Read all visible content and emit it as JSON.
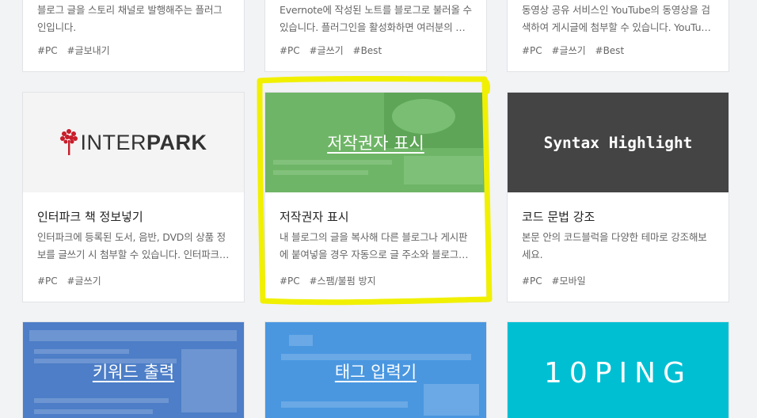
{
  "cards": [
    {
      "title": "",
      "desc": "블로그 글을 스토리 채널로 발행해주는 플러그인입니다.",
      "tags": [
        "#PC",
        "#글보내기"
      ]
    },
    {
      "title": "",
      "desc": "Evernote에 작성된 노트를 블로그로 불러올 수 있습니다. 플러그인을 활성화하면 여러분의 …",
      "tags": [
        "#PC",
        "#글쓰기",
        "#Best"
      ]
    },
    {
      "title": "",
      "desc": "동영상 공유 서비스인 YouTube의 동영상을 검색하여 게시글에 첨부할 수 있습니다. YouTu…",
      "tags": [
        "#PC",
        "#글쓰기",
        "#Best"
      ]
    },
    {
      "thumb_logo": {
        "prefix": "INTER",
        "suffix": "PARK"
      },
      "title": "인터파크 책 정보넣기",
      "desc": "인터파크에 등록된 도서, 음반, DVD의 상품 정보를 글쓰기 시 첨부할 수 있습니다. 인터파크…",
      "tags": [
        "#PC",
        "#글쓰기"
      ]
    },
    {
      "thumb_label": "저작권자 표시",
      "title": "저작권자 표시",
      "desc": "내 블로그의 글을 복사해 다른 블로그나 게시판에 붙여넣을 경우 자동으로 글 주소와 블로그…",
      "tags": [
        "#PC",
        "#스팸/불펌 방지"
      ]
    },
    {
      "thumb_label": "Syntax Highlight",
      "title": "코드 문법 강조",
      "desc": "본문 안의 코드블럭을 다양한 테마로 강조해보세요.",
      "tags": [
        "#PC",
        "#모바일"
      ]
    },
    {
      "thumb_label": "키워드 출력"
    },
    {
      "thumb_label": "태그 입력기"
    },
    {
      "thumb_label": "10PING"
    }
  ],
  "colors": {
    "page_bg": "#f2f3f5",
    "highlight": "#f0f000",
    "copyright_thumb": "#6fb567",
    "syntax_thumb": "#444444",
    "keyword_thumb": "#4d7ec7",
    "tag_thumb": "#4a97e0",
    "ping_thumb": "#00bfd3"
  }
}
